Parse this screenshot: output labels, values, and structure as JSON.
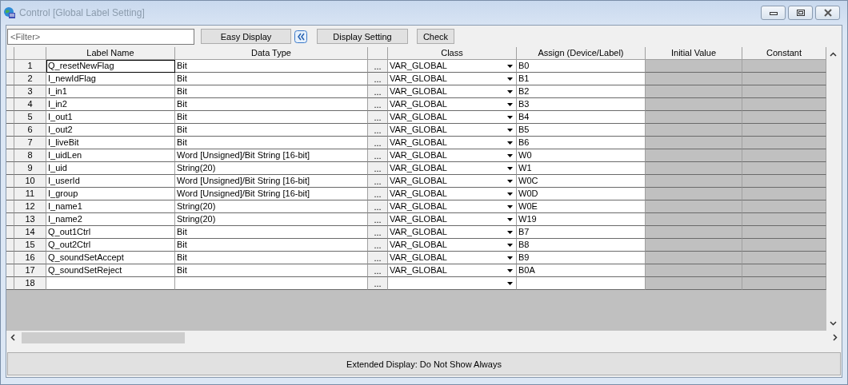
{
  "window": {
    "title": "Control [Global Label Setting]"
  },
  "toolbar": {
    "filter": {
      "placeholder": "<Filter>"
    },
    "buttons": [
      {
        "label": "Easy Display",
        "kind": "collapse"
      },
      {
        "label": "Display Setting",
        "kind": "plain"
      },
      {
        "label": "Check",
        "kind": "plain"
      }
    ]
  },
  "table": {
    "columns": [
      "Label Name",
      "Data Type",
      "Class",
      "Assign (Device/Label)",
      "Initial Value",
      "Constant"
    ],
    "rows": [
      {
        "number": "1",
        "label_name": "Q_resetNewFlag",
        "data_type": "Bit",
        "browse": "...",
        "class": "VAR_GLOBAL",
        "assign": "B0",
        "selected": true
      },
      {
        "number": "2",
        "label_name": "I_newIdFlag",
        "data_type": "Bit",
        "browse": "...",
        "class": "VAR_GLOBAL",
        "assign": "B1",
        "selected": false
      },
      {
        "number": "3",
        "label_name": "I_in1",
        "data_type": "Bit",
        "browse": "...",
        "class": "VAR_GLOBAL",
        "assign": "B2",
        "selected": false
      },
      {
        "number": "4",
        "label_name": "I_in2",
        "data_type": "Bit",
        "browse": "...",
        "class": "VAR_GLOBAL",
        "assign": "B3",
        "selected": false
      },
      {
        "number": "5",
        "label_name": "I_out1",
        "data_type": "Bit",
        "browse": "...",
        "class": "VAR_GLOBAL",
        "assign": "B4",
        "selected": false
      },
      {
        "number": "6",
        "label_name": "I_out2",
        "data_type": "Bit",
        "browse": "...",
        "class": "VAR_GLOBAL",
        "assign": "B5",
        "selected": false
      },
      {
        "number": "7",
        "label_name": "I_liveBit",
        "data_type": "Bit",
        "browse": "...",
        "class": "VAR_GLOBAL",
        "assign": "B6",
        "selected": false
      },
      {
        "number": "8",
        "label_name": "I_uidLen",
        "data_type": "Word [Unsigned]/Bit String [16-bit]",
        "browse": "...",
        "class": "VAR_GLOBAL",
        "assign": "W0",
        "selected": false
      },
      {
        "number": "9",
        "label_name": "I_uid",
        "data_type": "String(20)",
        "browse": "...",
        "class": "VAR_GLOBAL",
        "assign": "W1",
        "selected": false
      },
      {
        "number": "10",
        "label_name": "I_userId",
        "data_type": "Word [Unsigned]/Bit String [16-bit]",
        "browse": "...",
        "class": "VAR_GLOBAL",
        "assign": "W0C",
        "selected": false
      },
      {
        "number": "11",
        "label_name": "I_group",
        "data_type": "Word [Unsigned]/Bit String [16-bit]",
        "browse": "...",
        "class": "VAR_GLOBAL",
        "assign": "W0D",
        "selected": false
      },
      {
        "number": "12",
        "label_name": "I_name1",
        "data_type": "String(20)",
        "browse": "...",
        "class": "VAR_GLOBAL",
        "assign": "W0E",
        "selected": false
      },
      {
        "number": "13",
        "label_name": "I_name2",
        "data_type": "String(20)",
        "browse": "...",
        "class": "VAR_GLOBAL",
        "assign": "W19",
        "selected": false
      },
      {
        "number": "14",
        "label_name": "Q_out1Ctrl",
        "data_type": "Bit",
        "browse": "...",
        "class": "VAR_GLOBAL",
        "assign": "B7",
        "selected": false
      },
      {
        "number": "15",
        "label_name": "Q_out2Ctrl",
        "data_type": "Bit",
        "browse": "...",
        "class": "VAR_GLOBAL",
        "assign": "B8",
        "selected": false
      },
      {
        "number": "16",
        "label_name": "Q_soundSetAccept",
        "data_type": "Bit",
        "browse": "...",
        "class": "VAR_GLOBAL",
        "assign": "B9",
        "selected": false
      },
      {
        "number": "17",
        "label_name": "Q_soundSetReject",
        "data_type": "Bit",
        "browse": "...",
        "class": "VAR_GLOBAL",
        "assign": "B0A",
        "selected": false
      },
      {
        "number": "18",
        "browse": "...",
        "selected": false
      }
    ]
  },
  "status_bar": "Extended Display: Do Not Show Always"
}
